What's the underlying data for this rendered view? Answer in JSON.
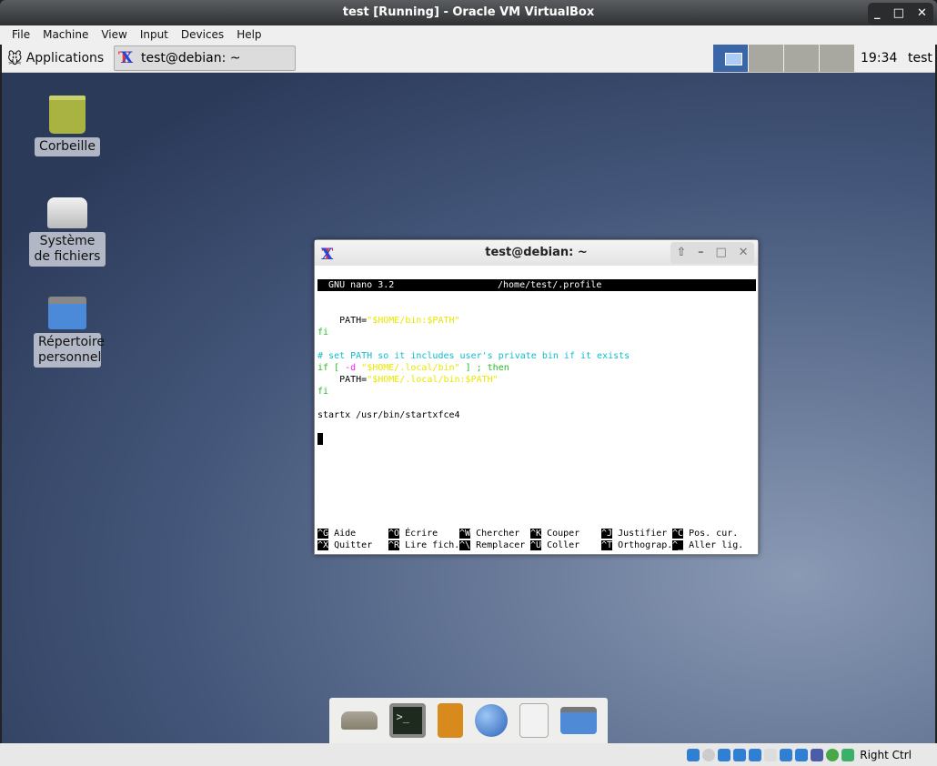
{
  "window": {
    "title": "test [Running] - Oracle VM VirtualBox",
    "controls": [
      "_",
      "□",
      "✕"
    ]
  },
  "menu": [
    "File",
    "Machine",
    "View",
    "Input",
    "Devices",
    "Help"
  ],
  "panel": {
    "applications": "Applications",
    "task": "test@debian: ~",
    "clock": "19:34",
    "user": "test",
    "workspaces": 4,
    "active_workspace": 1
  },
  "desktop_icons": [
    {
      "label": "Corbeille",
      "icon": "trash-icon"
    },
    {
      "label": "Système de fichiers",
      "icon": "drive-icon"
    },
    {
      "label": "Répertoire personnel",
      "icon": "home-folder-icon"
    }
  ],
  "terminal": {
    "title": "test@debian: ~",
    "controls": [
      "⇧",
      "–",
      "□",
      "✕"
    ],
    "nano_header": {
      "left": "  GNU nano 3.2",
      "right": "/home/test/.profile"
    },
    "lines": [
      [],
      [
        {
          "t": "    PATH=",
          "c": "#000000"
        },
        {
          "t": "\"$HOME/bin:$PATH\"",
          "c": "#e8e800"
        }
      ],
      [
        {
          "t": "fi",
          "c": "#22bb22"
        }
      ],
      [],
      [
        {
          "t": "# set PATH so it includes user's private bin if it exists",
          "c": "#11bbcc"
        }
      ],
      [
        {
          "t": "if [ ",
          "c": "#22bb22"
        },
        {
          "t": "-d",
          "c": "#ee22ee"
        },
        {
          "t": " ",
          "c": "#000"
        },
        {
          "t": "\"$HOME/.local/bin\"",
          "c": "#e8e800"
        },
        {
          "t": " ] ; then",
          "c": "#22bb22"
        }
      ],
      [
        {
          "t": "    PATH=",
          "c": "#000000"
        },
        {
          "t": "\"$HOME/.local/bin:$PATH\"",
          "c": "#e8e800"
        }
      ],
      [
        {
          "t": "fi",
          "c": "#22bb22"
        }
      ],
      [],
      [
        {
          "t": "startx /usr/bin/startxfce4",
          "c": "#000000"
        }
      ]
    ],
    "shortcuts": [
      [
        {
          "k": "^G",
          "l": " Aide      "
        },
        {
          "k": "^O",
          "l": " Écrire    "
        },
        {
          "k": "^W",
          "l": " Chercher  "
        },
        {
          "k": "^K",
          "l": " Couper    "
        },
        {
          "k": "^J",
          "l": " Justifier "
        },
        {
          "k": "^C",
          "l": " Pos. cur."
        }
      ],
      [
        {
          "k": "^X",
          "l": " Quitter   "
        },
        {
          "k": "^R",
          "l": " Lire fich."
        },
        {
          "k": "^\\",
          "l": " Remplacer "
        },
        {
          "k": "^U",
          "l": " Coller    "
        },
        {
          "k": "^T",
          "l": " Orthograp."
        },
        {
          "k": "^_",
          "l": " Aller lig."
        }
      ]
    ]
  },
  "dock": [
    "show-desktop-icon",
    "terminal-icon",
    "file-cabinet-icon",
    "web-browser-icon",
    "search-document-icon",
    "folder-icon"
  ],
  "statusbar": {
    "host_key": "Right Ctrl"
  }
}
